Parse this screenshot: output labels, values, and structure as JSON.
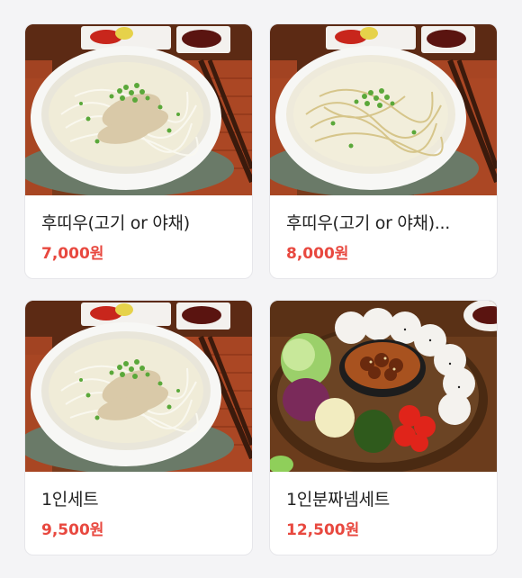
{
  "menu": {
    "items": [
      {
        "name": "후띠우(고기 or 야채)",
        "price": "7,000원",
        "image": "pho-with-sliced-beef"
      },
      {
        "name": "후띠우(고기 or 야채)...",
        "price": "8,000원",
        "image": "pho-vegetable"
      },
      {
        "name": "1인세트",
        "price": "9,500원",
        "image": "pho-with-sliced-beef"
      },
      {
        "name": "1인분짜넴세트",
        "price": "12,500원",
        "image": "bun-cha-platter"
      }
    ]
  },
  "colors": {
    "price": "#e8483f",
    "name": "#222222",
    "card_border": "#e6e6ea",
    "background": "#f4f4f6"
  }
}
